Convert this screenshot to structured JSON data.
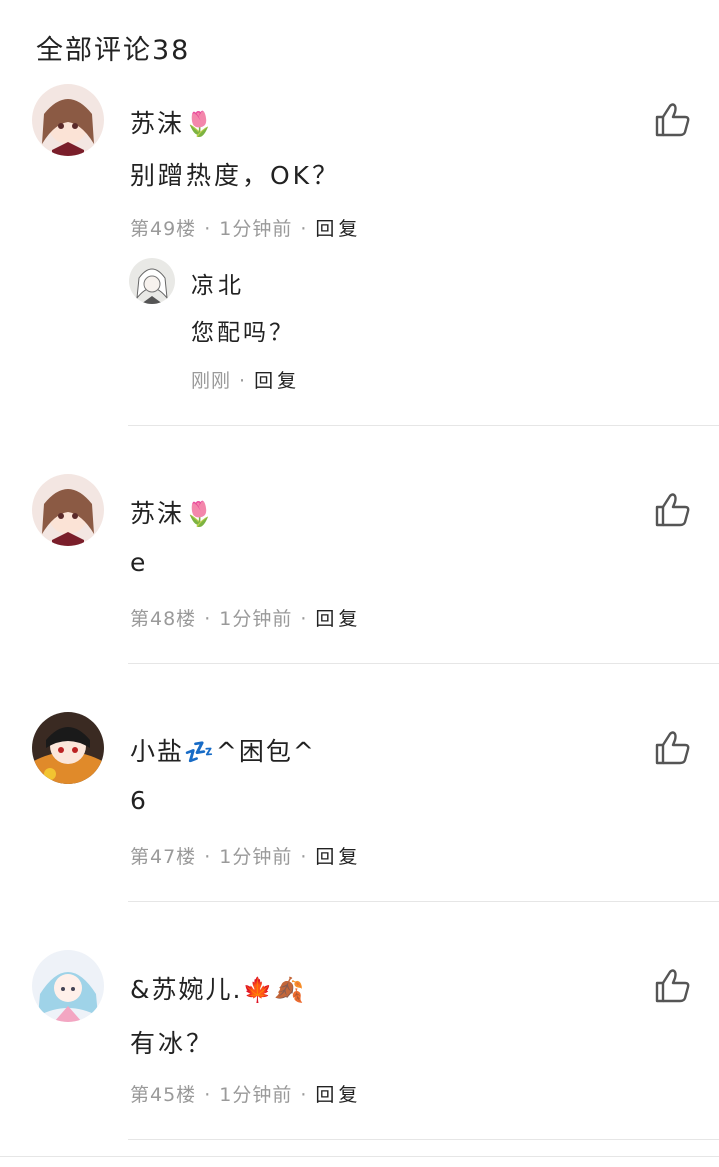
{
  "header": {
    "title": "全部评论38"
  },
  "comments": [
    {
      "username": "苏沫",
      "username_emoji": "🌷",
      "text": "别蹭热度，OK？",
      "floor": "第49楼",
      "time": "1分钟前",
      "reply_label": "回复",
      "sub_reply": {
        "username": "凉北",
        "text": "您配吗？",
        "time": "刚刚",
        "reply_label": "回复"
      }
    },
    {
      "username": "苏沫",
      "username_emoji": "🌷",
      "text": "e",
      "floor": "第48楼",
      "time": "1分钟前",
      "reply_label": "回复"
    },
    {
      "username": "小盐",
      "username_emoji": "💤",
      "username_suffix": "^困包^",
      "text": "6",
      "floor": "第47楼",
      "time": "1分钟前",
      "reply_label": "回复"
    },
    {
      "username": "&苏婉儿.",
      "username_emoji": "🍁🍂",
      "text": "有冰？",
      "floor": "第45楼",
      "time": "1分钟前",
      "reply_label": "回复"
    }
  ],
  "colors": {
    "meta": "#9a9a9a",
    "text": "#222222",
    "divider": "#e6e6e6"
  }
}
